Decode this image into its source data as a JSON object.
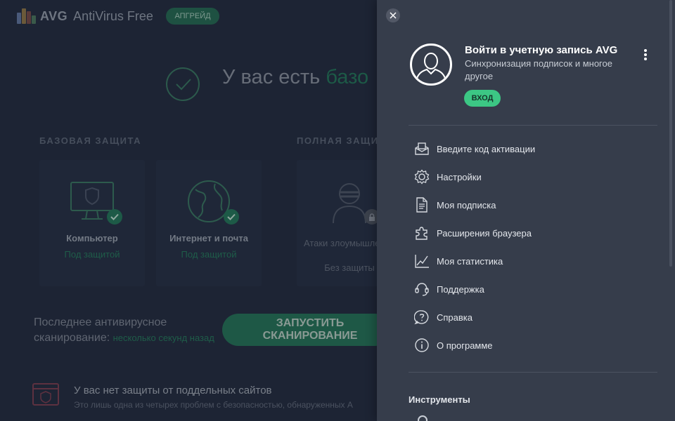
{
  "window": {
    "brand": "AVG",
    "product": "AntiVirus Free",
    "upgrade_label": "АПГРЕЙД"
  },
  "status": {
    "title_prefix": "У вас есть ",
    "title_highlight": "базо"
  },
  "sections": {
    "basic": "БАЗОВАЯ ЗАЩИТА",
    "full": "ПОЛНАЯ ЗАЩИ"
  },
  "cards": [
    {
      "name": "Компьютер",
      "state": "Под защитой",
      "icon": "computer-icon"
    },
    {
      "name": "Интернет и почта",
      "state": "Под защитой",
      "icon": "globe-icon"
    },
    {
      "name": "Атаки злоумышленни",
      "state": "Без защиты",
      "icon": "hacker-icon"
    }
  ],
  "scan": {
    "label": "Последнее антивирусное сканирование:",
    "label_line1": "Последнее антивирусное",
    "label_line2": "сканирование:",
    "value": "несколько секунд назад",
    "button_line1": "ЗАПУСТИТЬ",
    "button_line2": "СКАНИРОВАНИЕ"
  },
  "warning": {
    "title": "У вас нет защиты от поддельных сайтов",
    "subtitle": "Это лишь одна из четырех проблем с безопасностью, обнаруженных А"
  },
  "panel": {
    "account_title": "Войти в учетную запись AVG",
    "account_subtitle": "Синхронизация подписок и многое другое",
    "login_label": "ВХОД",
    "menu": [
      {
        "label": "Введите код активации",
        "icon": "activation-code-icon"
      },
      {
        "label": "Настройки",
        "icon": "gear-icon"
      },
      {
        "label": "Моя подписка",
        "icon": "document-icon"
      },
      {
        "label": "Расширения браузера",
        "icon": "puzzle-icon"
      },
      {
        "label": "Моя статистика",
        "icon": "chart-icon"
      },
      {
        "label": "Поддержка",
        "icon": "headset-icon"
      },
      {
        "label": "Справка",
        "icon": "help-icon"
      },
      {
        "label": "О программе",
        "icon": "info-icon"
      }
    ],
    "tools_title": "Инструменты"
  },
  "colors": {
    "accent_green": "#3cc784",
    "panel_bg": "#363d4b",
    "main_bg": "#1d2434"
  }
}
